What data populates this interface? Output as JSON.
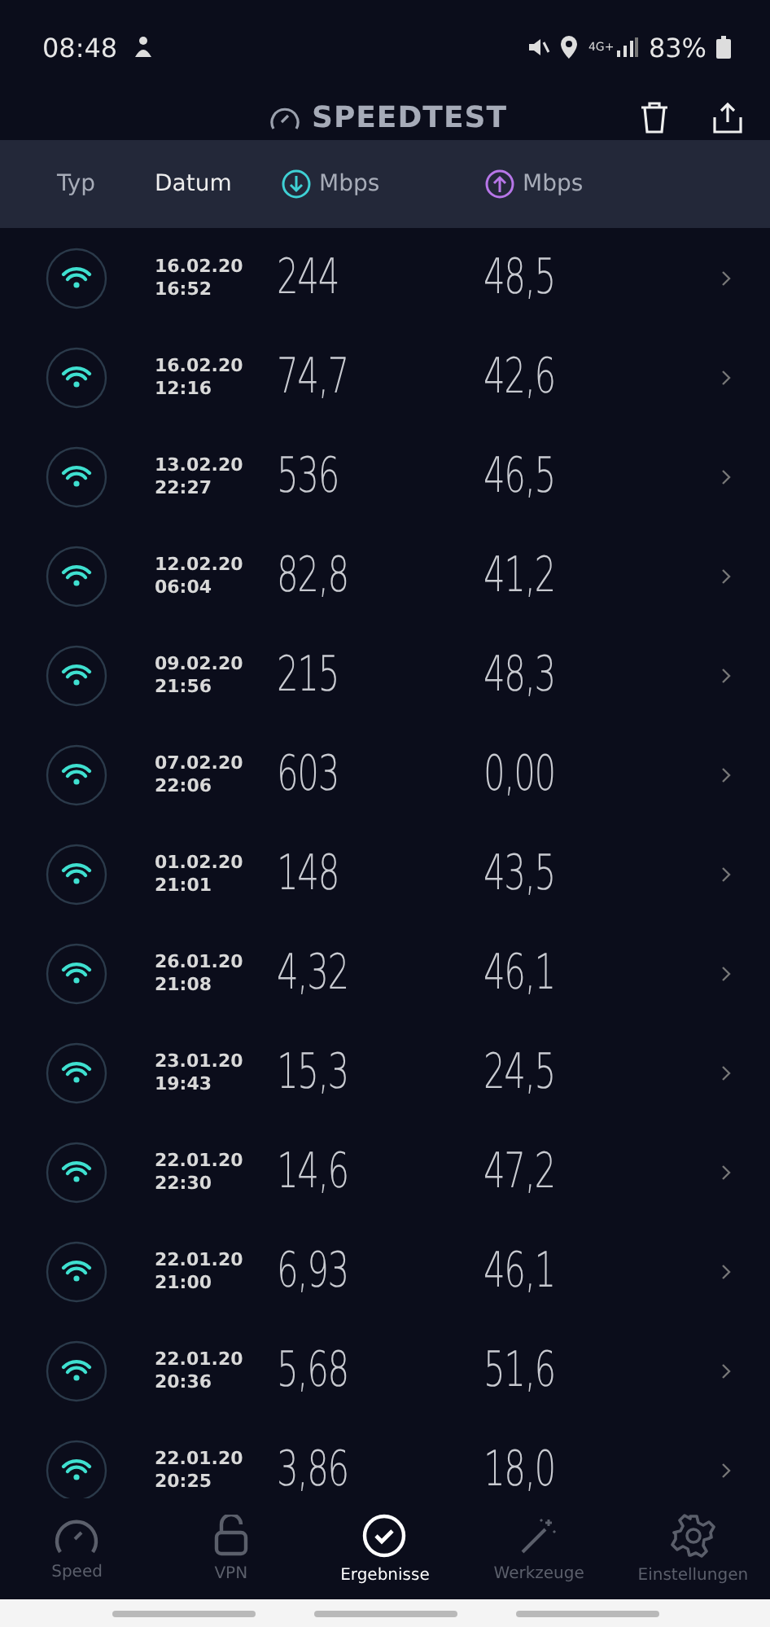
{
  "status_bar": {
    "time": "08:48",
    "battery": "83%",
    "network": "4G+"
  },
  "header": {
    "title": "SPEEDTEST"
  },
  "table": {
    "columns": [
      {
        "label": "Typ",
        "kind": "text"
      },
      {
        "label": "Datum",
        "kind": "text"
      },
      {
        "label": "Mbps",
        "kind": "download"
      },
      {
        "label": "Mbps",
        "kind": "upload"
      }
    ],
    "rows": [
      {
        "date": "16.02.20",
        "time": "16:52",
        "download": "244",
        "upload": "48,5"
      },
      {
        "date": "16.02.20",
        "time": "12:16",
        "download": "74,7",
        "upload": "42,6"
      },
      {
        "date": "13.02.20",
        "time": "22:27",
        "download": "536",
        "upload": "46,5"
      },
      {
        "date": "12.02.20",
        "time": "06:04",
        "download": "82,8",
        "upload": "41,2"
      },
      {
        "date": "09.02.20",
        "time": "21:56",
        "download": "215",
        "upload": "48,3"
      },
      {
        "date": "07.02.20",
        "time": "22:06",
        "download": "603",
        "upload": "0,00"
      },
      {
        "date": "01.02.20",
        "time": "21:01",
        "download": "148",
        "upload": "43,5"
      },
      {
        "date": "26.01.20",
        "time": "21:08",
        "download": "4,32",
        "upload": "46,1"
      },
      {
        "date": "23.01.20",
        "time": "19:43",
        "download": "15,3",
        "upload": "24,5"
      },
      {
        "date": "22.01.20",
        "time": "22:30",
        "download": "14,6",
        "upload": "47,2"
      },
      {
        "date": "22.01.20",
        "time": "21:00",
        "download": "6,93",
        "upload": "46,1"
      },
      {
        "date": "22.01.20",
        "time": "20:36",
        "download": "5,68",
        "upload": "51,6"
      },
      {
        "date": "22.01.20",
        "time": "20:25",
        "download": "3,86",
        "upload": "18,0"
      }
    ]
  },
  "nav": [
    {
      "label": "Speed",
      "kind": "speed",
      "selected": false
    },
    {
      "label": "VPN",
      "kind": "vpn",
      "selected": false
    },
    {
      "label": "Ergebnisse",
      "kind": "results",
      "selected": true
    },
    {
      "label": "Werkzeuge",
      "kind": "tools",
      "selected": false
    },
    {
      "label": "Einstellungen",
      "kind": "settings",
      "selected": false
    }
  ]
}
